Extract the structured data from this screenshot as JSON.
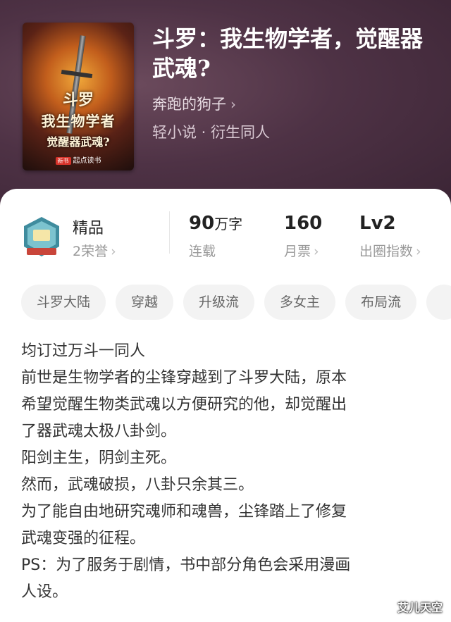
{
  "book": {
    "title": "斗罗：我生物学者，觉醒器武魂?",
    "author": "奔跑的狗子",
    "genre": "轻小说 · 衍生同人"
  },
  "cover": {
    "line1": "斗罗",
    "line2": "我生物学者",
    "line3": "觉醒器武魂?",
    "publisher": "起点读书",
    "badge": "新书"
  },
  "stats": {
    "quality_label": "精品",
    "honor": "2荣誉",
    "word_count": "90",
    "word_unit": "万字",
    "status": "连载",
    "monthly_tickets": "160",
    "monthly_tickets_label": "月票",
    "level": "Lv2",
    "level_label": "出圈指数"
  },
  "tags": [
    "斗罗大陆",
    "穿越",
    "升级流",
    "多女主",
    "布局流"
  ],
  "description": [
    "均订过万斗一同人",
    "前世是生物学者的尘锋穿越到了斗罗大陆，原本",
    "希望觉醒生物类武魂以方便研究的他，却觉醒出",
    "了器武魂太极八卦剑。",
    "阳剑主生，阴剑主死。",
    "然而，武魂破损，八卦只余其三。",
    "为了能自由地研究魂师和魂兽，尘锋踏上了修复",
    "武魂变强的征程。",
    "PS：为了服务于剧情，书中部分角色会采用漫画",
    "人设。"
  ],
  "watermark": "艾儿天空",
  "colors": {
    "header_bg": "#4e3245",
    "card_bg": "#ffffff",
    "tag_bg": "#f3f3f3"
  }
}
